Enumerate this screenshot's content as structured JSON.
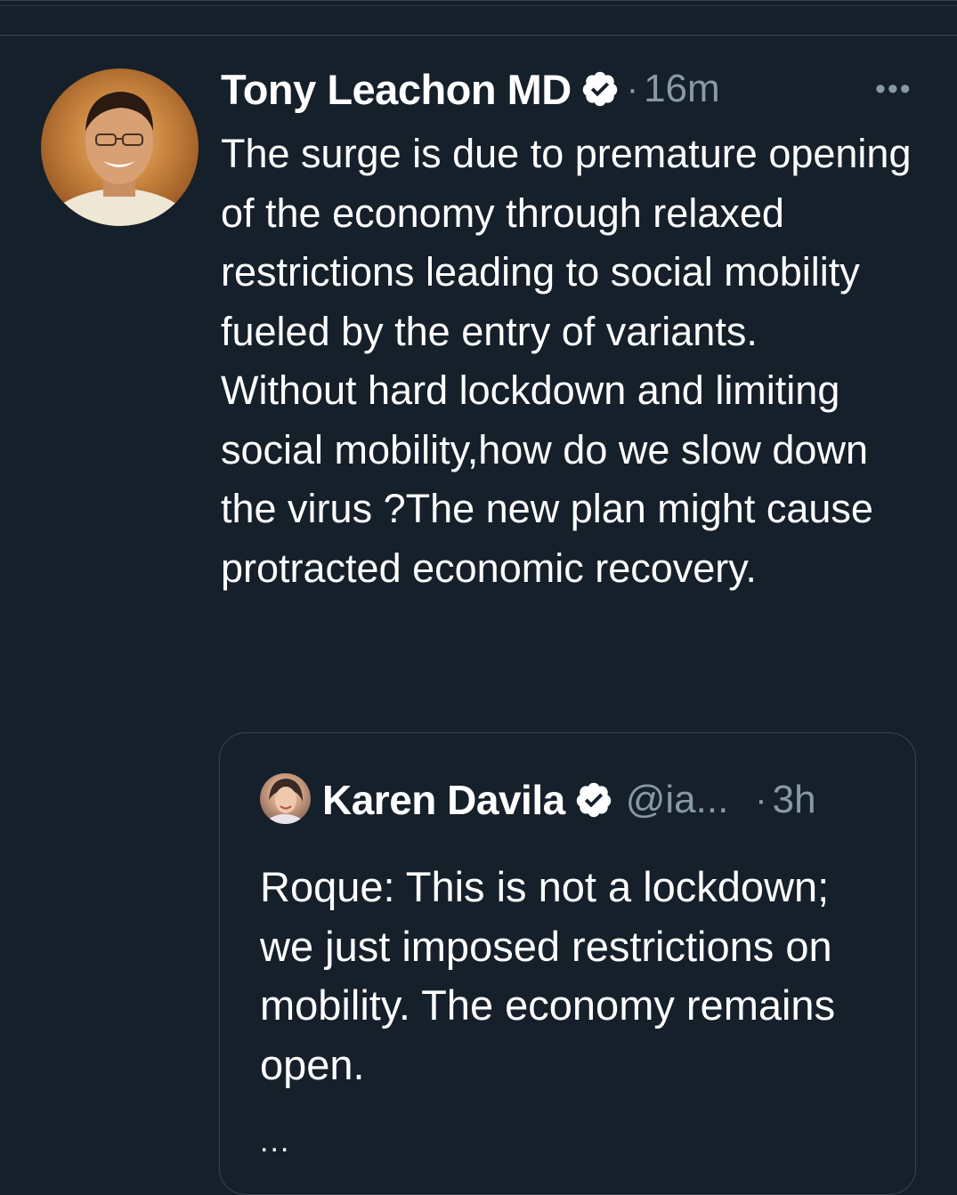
{
  "tweet": {
    "author_name": "Tony Leachon MD",
    "verified": true,
    "separator": "·",
    "time": "16m",
    "more_label": "•••",
    "text": "The surge is due to premature opening of the economy through relaxed restrictions leading to social mobility fueled by the entry of variants.\nWithout hard lockdown and limiting social mobility,how do we slow down the virus ?The new plan might cause protracted economic recovery."
  },
  "quote": {
    "author_name": "Karen Davila",
    "verified": true,
    "handle": "@ia...",
    "separator": "·",
    "time": "3h",
    "text": "Roque: This is not a lockdown; we just imposed restrictions on mobility. The economy remains open.",
    "ellipsis": "..."
  },
  "colors": {
    "background": "#15202b",
    "text": "#ffffff",
    "secondary_text": "#8899a6",
    "border": "#38444d"
  },
  "icons": {
    "verified": "verified-badge-icon",
    "more": "more-options-icon"
  }
}
